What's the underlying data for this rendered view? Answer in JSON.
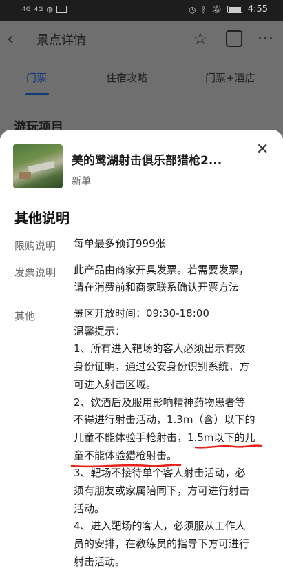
{
  "status_bar": {
    "signal_1": "4G",
    "signal_2": "4G",
    "time": "4:55",
    "battery_level_fraction": 0.9,
    "icons": [
      "signal-icon",
      "signal-icon",
      "messenger-icon",
      "mail-icon",
      "alarm-icon",
      "bluetooth-icon",
      "mute-icon",
      "battery-icon"
    ]
  },
  "nav": {
    "title": "景点详情",
    "icons": [
      "back-icon",
      "star-icon",
      "share-icon",
      "more-icon"
    ]
  },
  "tabs": [
    {
      "label": "门票",
      "active": true
    },
    {
      "label": "住宿攻略",
      "active": false
    },
    {
      "label": "门票+酒店",
      "active": false
    }
  ],
  "background_section_title": "游玩项目",
  "sheet": {
    "product_title": "美的鹭湖射击俱乐部猎枪2...",
    "product_tag": "新单",
    "section_title": "其他说明",
    "rows": [
      {
        "label": "限购说明",
        "lines": [
          "每单最多预订999张"
        ]
      },
      {
        "label": "发票说明",
        "lines": [
          "此产品由商家开具发票。若需要发票，",
          "请在消费前和商家联系确认开票方法"
        ]
      },
      {
        "label": "其他",
        "lines": [
          "景区开放时间：09:30-18:00",
          "温馨提示：",
          "1、所有进入靶场的客人必须出示有效",
          "身份证明，通过公安身份识别系统，方",
          "可进入射击区域。",
          "2、饮酒后及服用影响精神药物患者等",
          "不得进行射击活动，1.3m（含）以下的",
          "儿童不能体验手枪射击，1.5m以下的儿",
          "童不能体验猎枪射击。",
          "3、靶场不接待单个客人射击活动，必",
          "须有朋友或家属陪同下，方可进行射击",
          "活动。",
          "4、进入靶场的客人，必须服从工作人",
          "员的安排，在教练员的指导下方可进行",
          "射击活动。"
        ]
      }
    ]
  },
  "colors": {
    "active_tab": "#0f3a7a",
    "annotation_red": "#e8201a",
    "overlay": "#6f6f6f"
  }
}
